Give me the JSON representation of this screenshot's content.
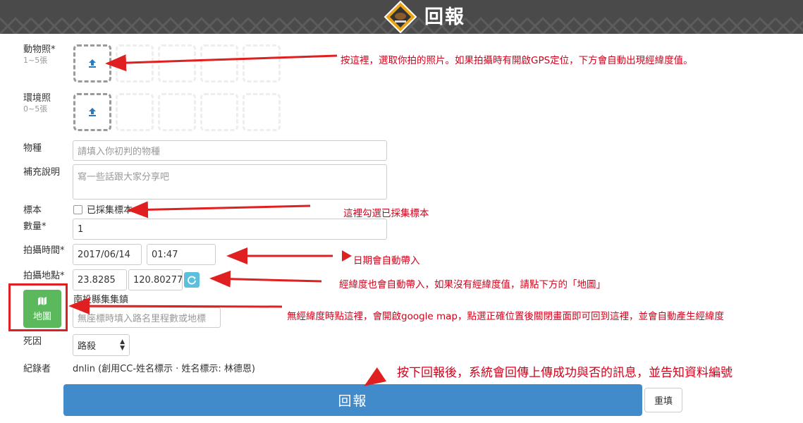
{
  "header": {
    "title": "回報"
  },
  "form": {
    "animal_photo": {
      "label": "動物照*",
      "hint": "1~5張"
    },
    "env_photo": {
      "label": "環境照",
      "hint": "0~5張"
    },
    "species": {
      "label": "物種",
      "placeholder": "請填入你初判的物種"
    },
    "remarks": {
      "label": "補充說明",
      "placeholder": "寫一些話跟大家分享吧"
    },
    "specimen": {
      "label": "標本",
      "checkbox_label": "已採集標本",
      "checked": false
    },
    "quantity": {
      "label": "數量*",
      "value": "1"
    },
    "shoot_time": {
      "label": "拍攝時間*",
      "date": "2017/06/14",
      "time": "01:47"
    },
    "shoot_place": {
      "label": "拍攝地點*",
      "lat": "23.8285",
      "lng": "120.80277",
      "location_name": "南投縣集集鎮",
      "landmark_placeholder": "無座標時填入路名里程數或地標"
    },
    "map_button": {
      "label": "地圖"
    },
    "cause": {
      "label": "死因",
      "selected": "路殺"
    },
    "recorder": {
      "label": "紀錄者",
      "value": "dnlin (創用CC-姓名標示 · 姓名標示: 林德恩)"
    },
    "submit_label": "回報",
    "reset_label": "重填"
  },
  "annotations": {
    "photo": "按這裡，選取你拍的照片。如果拍攝時有開啟GPS定位，下方會自動出現經緯度值。",
    "specimen": "這裡勾選已採集標本",
    "date": "日期會自動帶入",
    "coords": "經緯度也會自動帶入，如果沒有經緯度值，請點下方的「地圖」",
    "map": "無經緯度時點這裡，會開啟google map，點選正確位置後關閉畫面即可回到這裡，並會自動產生經緯度",
    "submit": "按下回報後，系統會回傳上傳成功與否的訊息，並告知資料編號"
  },
  "colors": {
    "header_bg": "#4a4a4a",
    "primary": "#428bca",
    "map_green": "#5cb85c",
    "annotation_red": "#d0021b",
    "refresh_blue": "#5bc0de"
  }
}
